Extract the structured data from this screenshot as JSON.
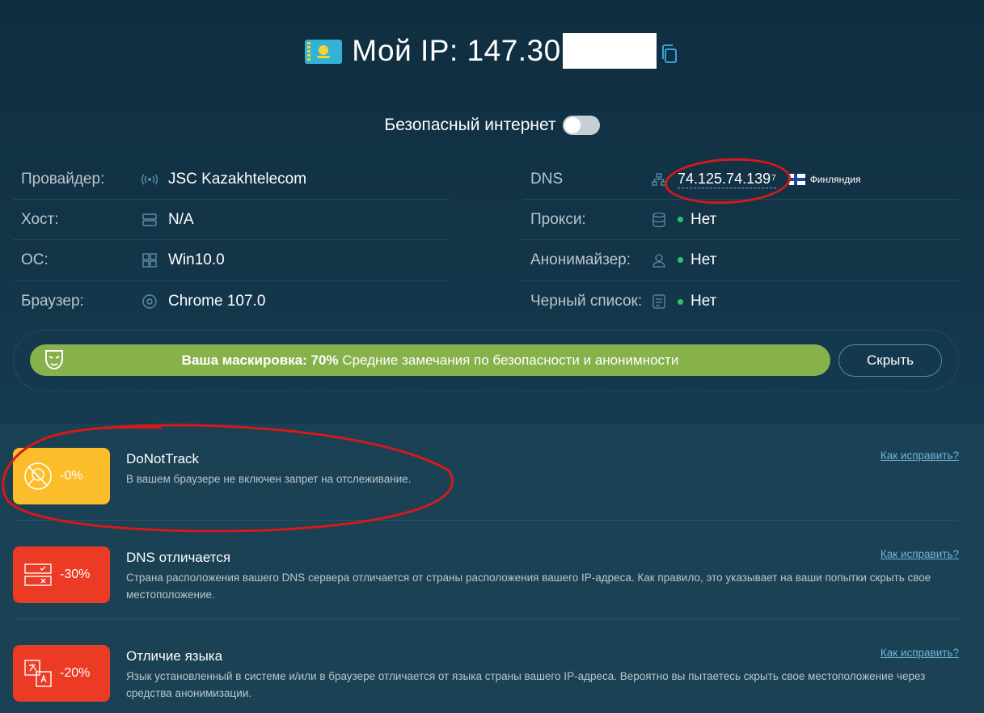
{
  "header": {
    "ip_label": "Мой IP: 147.30",
    "safe_internet_label": "Безопасный интернет"
  },
  "info": {
    "left": [
      {
        "key": "Провайдер:",
        "value": "JSC Kazakhtelecom",
        "icon": "wifi-signal-icon"
      },
      {
        "key": "Хост:",
        "value": "N/A",
        "icon": "server-icon"
      },
      {
        "key": "ОС:",
        "value": "Win10.0",
        "icon": "windows-icon"
      },
      {
        "key": "Браузер:",
        "value": "Chrome 107.0",
        "icon": "chrome-icon"
      }
    ],
    "right": [
      {
        "key": "DNS",
        "value": "74.125.74.139",
        "sup": "7",
        "country": "Финляндия",
        "icon": "network-icon"
      },
      {
        "key": "Прокси:",
        "value": "Нет",
        "icon": "database-icon"
      },
      {
        "key": "Анонимайзер:",
        "value": "Нет",
        "icon": "user-icon"
      },
      {
        "key": "Черный список:",
        "value": "Нет",
        "icon": "list-check-icon"
      }
    ]
  },
  "mask": {
    "label_bold": "Ваша маскировка: 70%",
    "label_rest": " Средние замечания по безопасности и анонимности",
    "hide_button": "Скрыть",
    "percent": 70
  },
  "issues": [
    {
      "badge": "-0%",
      "badge_color": "#fbbd2a",
      "title": "DoNotTrack",
      "desc": "В вашем браузере не включен запрет на отслеживание.",
      "fix": "Как исправить?",
      "icon": "no-tracking-icon"
    },
    {
      "badge": "-30%",
      "badge_color": "#ec3b25",
      "title": "DNS отличается",
      "desc": "Страна расположения вашего DNS сервера отличается от страны расположения вашего IP-адреса. Как правило, это указывает на ваши попытки скрыть свое местоположение.",
      "fix": "Как исправить?",
      "icon": "dns-servers-icon"
    },
    {
      "badge": "-20%",
      "badge_color": "#ec3b25",
      "title": "Отличие языка",
      "desc": "Язык установленный в системе и/или в браузере отличается от языка страны вашего IP-адреса. Вероятно вы пытаетесь скрыть свое местоположение через средства анонимизации.",
      "fix": "Как исправить?",
      "icon": "language-icon"
    }
  ],
  "colors": {
    "background": "#1a4154",
    "accent_green": "#86b14b",
    "status_green": "#30c46a",
    "link": "#6fb6d8",
    "annotation_red": "#d41a1a"
  }
}
